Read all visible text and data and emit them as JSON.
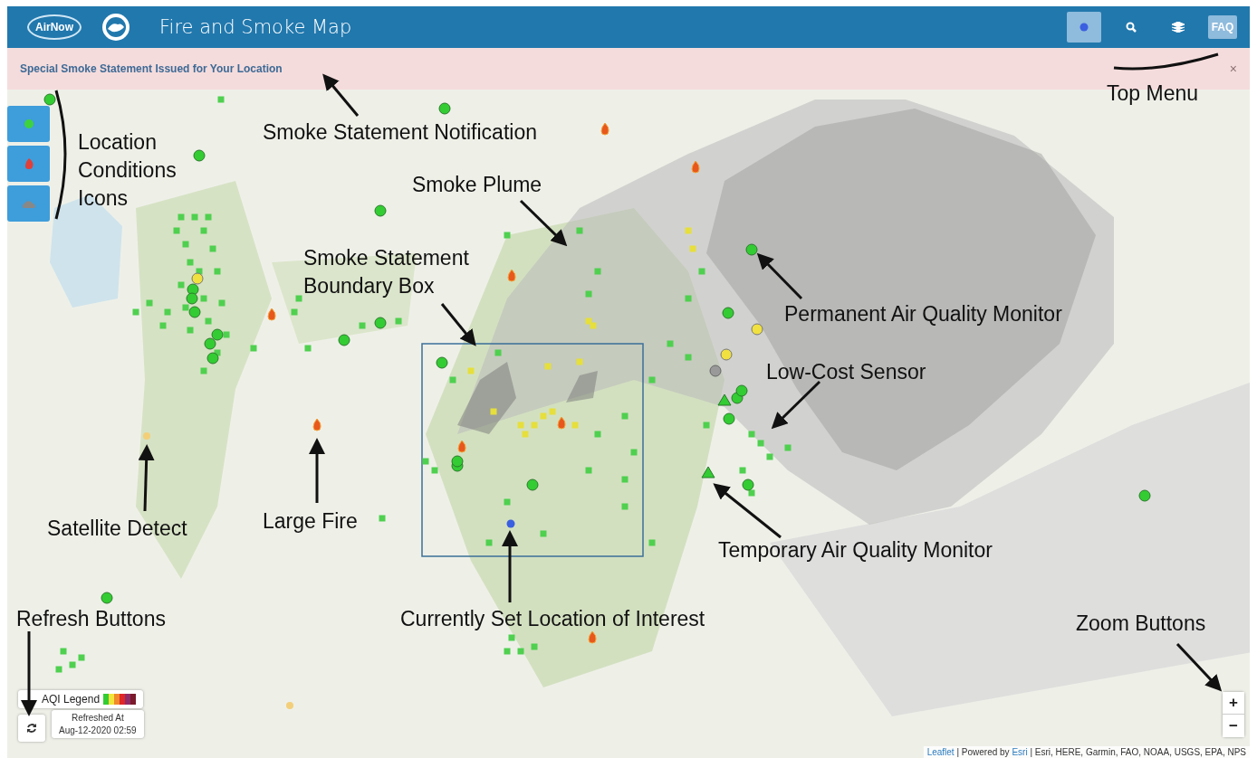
{
  "header": {
    "logo_text": "AirNow",
    "title": "Fire and Smoke Map",
    "menu": [
      {
        "kind": "location",
        "selected": true
      },
      {
        "kind": "search",
        "selected": false
      },
      {
        "kind": "layers",
        "selected": false
      },
      {
        "kind": "faq",
        "label": "FAQ",
        "selected": false
      }
    ]
  },
  "notification": {
    "text": "Special Smoke Statement Issued for Your Location",
    "close": "×"
  },
  "condition_icons": [
    {
      "kind": "monitor"
    },
    {
      "kind": "fire"
    },
    {
      "kind": "smoke"
    }
  ],
  "annotations": [
    {
      "text": "Top Menu"
    },
    {
      "text": "Smoke Statement Notification"
    },
    {
      "text": "Location Conditions Icons"
    },
    {
      "text": "Smoke Plume"
    },
    {
      "text": "Smoke Statement Boundary Box"
    },
    {
      "text": "Permanent Air Quality Monitor"
    },
    {
      "text": "Low-Cost Sensor"
    },
    {
      "text": "Satellite Detect"
    },
    {
      "text": "Large Fire"
    },
    {
      "text": "Temporary Air Quality Monitor"
    },
    {
      "text": "Refresh Buttons"
    },
    {
      "text": "Currently Set Location of Interest"
    },
    {
      "text": "Zoom Buttons"
    }
  ],
  "legend": {
    "title": "AQI Legend",
    "refreshed_label": "Refreshed At",
    "refreshed_time": "Aug-12-2020 02:59"
  },
  "zoom": {
    "in": "+",
    "out": "−"
  },
  "attribution": {
    "leaflet": "Leaflet",
    "powered": " | Powered by ",
    "esri": "Esri",
    "sources": " | Esri, HERE, Garmin, FAO, NOAA, USGS, EPA, NPS"
  }
}
